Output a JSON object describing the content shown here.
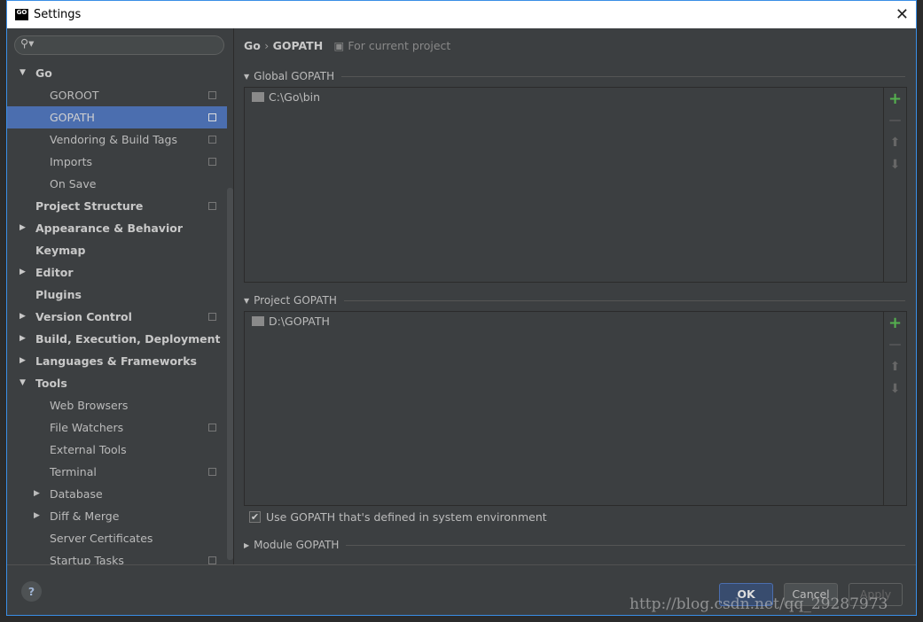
{
  "window": {
    "title": "Settings",
    "close": "✕"
  },
  "search": {
    "placeholder": "",
    "icon": "search-icon"
  },
  "tree": [
    {
      "label": "Go",
      "level": 0,
      "arrow": "down",
      "bold": true
    },
    {
      "label": "GOROOT",
      "level": 2,
      "copy": true
    },
    {
      "label": "GOPATH",
      "level": 2,
      "copy": true,
      "selected": true
    },
    {
      "label": "Vendoring & Build Tags",
      "level": 2,
      "copy": true
    },
    {
      "label": "Imports",
      "level": 2,
      "copy": true
    },
    {
      "label": "On Save",
      "level": 2
    },
    {
      "label": "Project Structure",
      "level": 1,
      "bold": true,
      "copy": true
    },
    {
      "label": "Appearance & Behavior",
      "level": 0,
      "arrow": "right",
      "bold": true
    },
    {
      "label": "Keymap",
      "level": 1,
      "bold": true
    },
    {
      "label": "Editor",
      "level": 0,
      "arrow": "right",
      "bold": true
    },
    {
      "label": "Plugins",
      "level": 1,
      "bold": true
    },
    {
      "label": "Version Control",
      "level": 0,
      "arrow": "right",
      "bold": true,
      "copy": true
    },
    {
      "label": "Build, Execution, Deployment",
      "level": 0,
      "arrow": "right",
      "bold": true
    },
    {
      "label": "Languages & Frameworks",
      "level": 0,
      "arrow": "right",
      "bold": true
    },
    {
      "label": "Tools",
      "level": 0,
      "arrow": "down",
      "bold": true
    },
    {
      "label": "Web Browsers",
      "level": 2
    },
    {
      "label": "File Watchers",
      "level": 2,
      "copy": true
    },
    {
      "label": "External Tools",
      "level": 2
    },
    {
      "label": "Terminal",
      "level": 2,
      "copy": true
    },
    {
      "label": "Database",
      "level": 3,
      "arrow": "right"
    },
    {
      "label": "Diff & Merge",
      "level": 3,
      "arrow": "right"
    },
    {
      "label": "Server Certificates",
      "level": 2
    },
    {
      "label": "Startup Tasks",
      "level": 2,
      "copy": true
    }
  ],
  "breadcrumb": {
    "parent": "Go",
    "sep": "›",
    "current": "GOPATH",
    "scope": "For current project"
  },
  "global": {
    "title": "Global GOPATH",
    "entries": [
      "C:\\Go\\bin"
    ]
  },
  "project": {
    "title": "Project GOPATH",
    "entries": [
      "D:\\GOPATH"
    ]
  },
  "use_system": {
    "label": "Use GOPATH that's defined in system environment",
    "checked": true
  },
  "module": {
    "title": "Module GOPATH"
  },
  "tools": {
    "add": "+",
    "remove": "—",
    "up": "⬆",
    "down": "⬇"
  },
  "buttons": {
    "help": "?",
    "ok": "OK",
    "cancel": "Cancel",
    "apply": "Apply"
  },
  "watermark": "http://blog.csdn.net/qq_29287973"
}
